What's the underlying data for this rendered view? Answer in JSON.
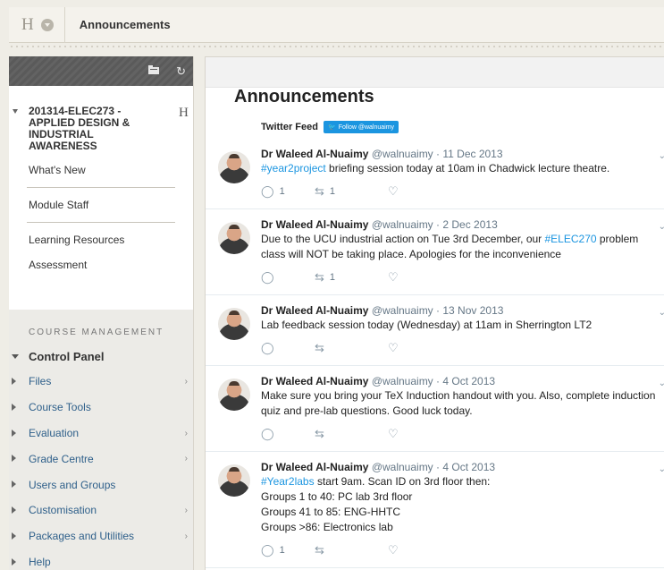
{
  "topbar": {
    "logo": "H",
    "title": "Announcements"
  },
  "leftnav": {
    "course": {
      "title": "201314-ELEC273 - APPLIED DESIGN & INDUSTRIAL AWARENESS",
      "badge": "H"
    },
    "links_top": [
      "What's New"
    ],
    "links_mid": [
      "Module Staff"
    ],
    "links_bottom": [
      "Learning Resources",
      "Assessment"
    ],
    "course_management": {
      "label": "COURSE MANAGEMENT",
      "control_panel": "Control Panel",
      "items": [
        {
          "label": "Files",
          "chevron": true
        },
        {
          "label": "Course Tools",
          "chevron": false
        },
        {
          "label": "Evaluation",
          "chevron": true
        },
        {
          "label": "Grade Centre",
          "chevron": true
        },
        {
          "label": "Users and Groups",
          "chevron": false
        },
        {
          "label": "Customisation",
          "chevron": true
        },
        {
          "label": "Packages and Utilities",
          "chevron": true
        },
        {
          "label": "Help",
          "chevron": false
        }
      ]
    }
  },
  "content": {
    "title": "Announcements",
    "feed_label": "Twitter Feed",
    "follow_label": "Follow @walnuaimy",
    "tweets": [
      {
        "author": "Dr Waleed Al-Nuaimy",
        "handle": "@walnuaimy",
        "date": "· 11 Dec 2013",
        "lines": [
          [
            "#year2project",
            " briefing session today at 10am in Chadwick lecture theatre."
          ]
        ],
        "replies": "1",
        "retweets": "1"
      },
      {
        "author": "Dr Waleed Al-Nuaimy",
        "handle": "@walnuaimy",
        "date": "· 2 Dec 2013",
        "lines": [
          [
            "",
            "Due to the UCU industrial action on Tue 3rd December, our "
          ],
          [
            "#ELEC270",
            " problem class will NOT be taking place. Apologies for the inconvenience"
          ]
        ],
        "replies": "",
        "retweets": "1"
      },
      {
        "author": "Dr Waleed Al-Nuaimy",
        "handle": "@walnuaimy",
        "date": "· 13 Nov 2013",
        "lines": [
          [
            "",
            "Lab feedback session today (Wednesday) at 11am in Sherrington LT2"
          ]
        ],
        "replies": "",
        "retweets": ""
      },
      {
        "author": "Dr Waleed Al-Nuaimy",
        "handle": "@walnuaimy",
        "date": "· 4 Oct 2013",
        "lines": [
          [
            "",
            "Make sure you bring your TeX Induction handout with you. Also, complete induction quiz and pre-lab questions. Good luck today."
          ]
        ],
        "replies": "",
        "retweets": ""
      },
      {
        "author": "Dr Waleed Al-Nuaimy",
        "handle": "@walnuaimy",
        "date": "· 4 Oct 2013",
        "lines": [
          [
            "#Year2labs",
            " start 9am. Scan ID on 3rd floor then:"
          ],
          [
            "",
            "Groups 1 to 40: PC lab 3rd floor"
          ],
          [
            "",
            "Groups 41 to 85: ENG-HHTC"
          ],
          [
            "",
            "Groups >86: Electronics lab"
          ]
        ],
        "replies": "1",
        "retweets": ""
      }
    ]
  }
}
